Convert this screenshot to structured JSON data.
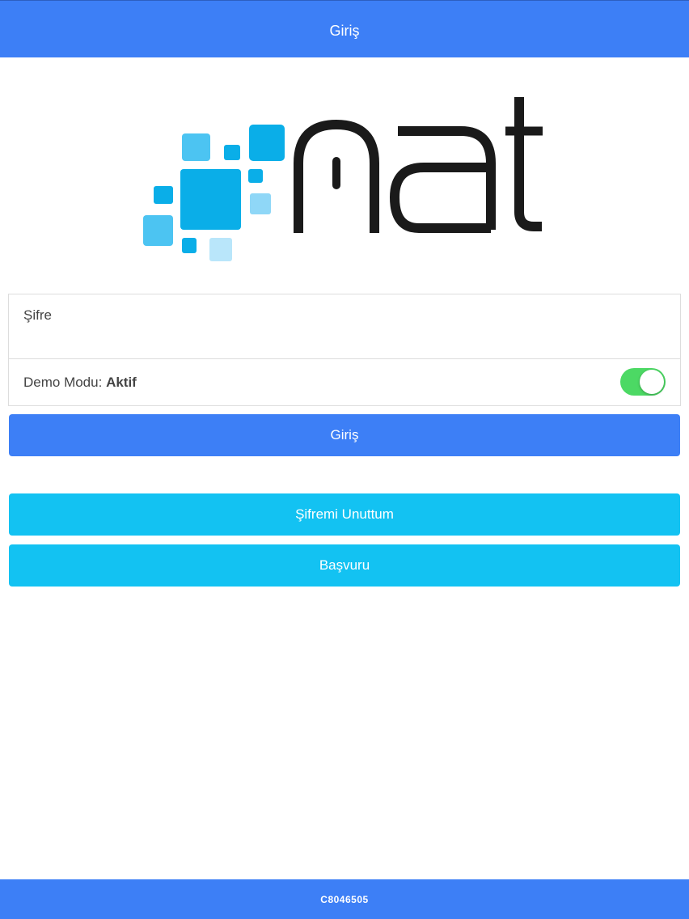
{
  "header": {
    "title": "Giriş"
  },
  "logo": {
    "icon": "nat-logo",
    "accent_colors": [
      "#0aaee8",
      "#4cc4f2",
      "#8fd7f7",
      "#b9e6fa"
    ],
    "wordmark_color": "#1a1a1a"
  },
  "form": {
    "password_placeholder": "Şifre",
    "password_value": "",
    "demo_label": "Demo Modu:",
    "demo_value": "Aktif",
    "demo_toggle_on": true
  },
  "buttons": {
    "login_label": "Giriş",
    "forgot_label": "Şifremi Unuttum",
    "apply_label": "Başvuru"
  },
  "footer": {
    "code": "C8046505"
  },
  "colors": {
    "primary": "#3d7ff6",
    "secondary": "#13c2f2",
    "toggle_on": "#4cd964"
  }
}
